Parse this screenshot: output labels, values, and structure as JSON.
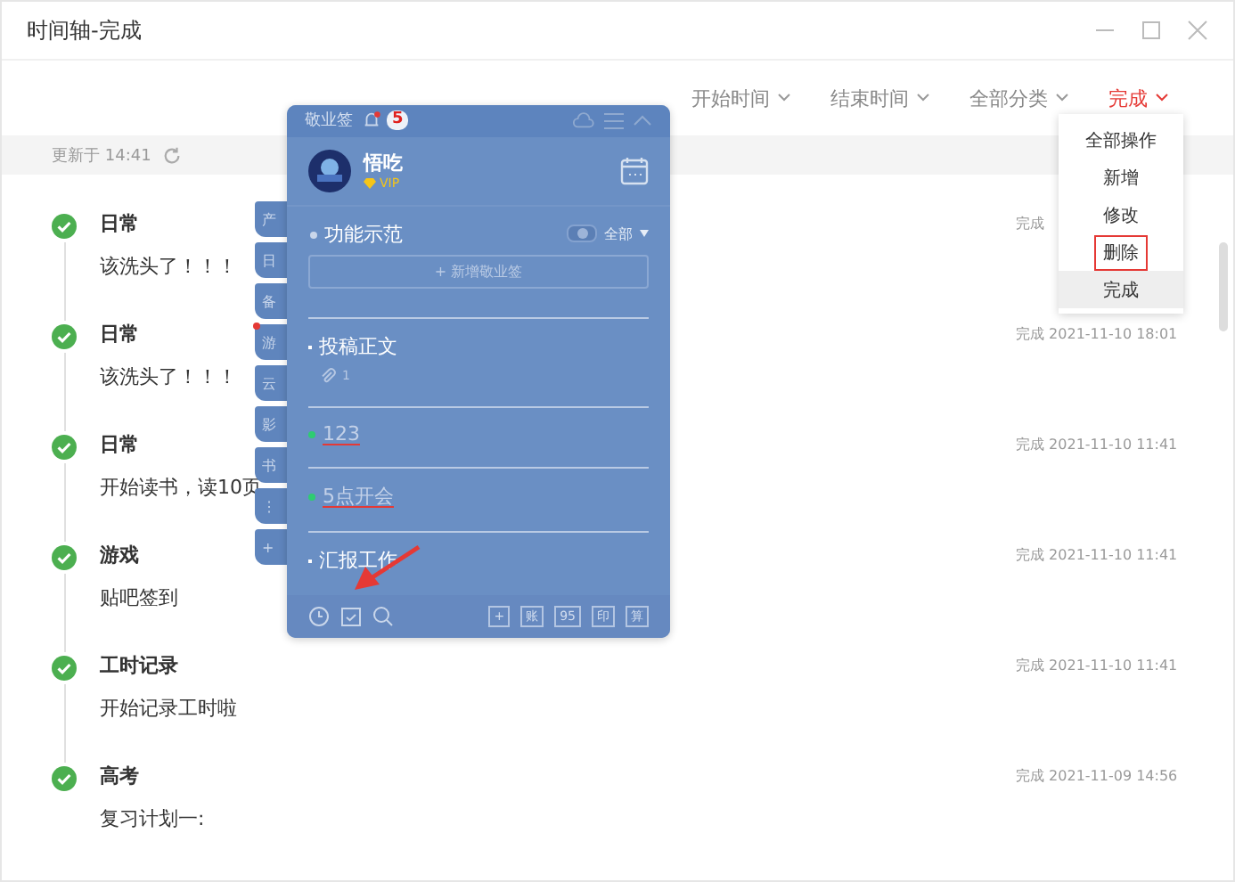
{
  "window": {
    "title": "时间轴-完成"
  },
  "filters": [
    {
      "label": "开始时间",
      "selected": false
    },
    {
      "label": "结束时间",
      "selected": false
    },
    {
      "label": "全部分类",
      "selected": false
    },
    {
      "label": "完成",
      "selected": true
    }
  ],
  "dropdown": [
    {
      "label": "全部操作",
      "selected": false,
      "outlined": false
    },
    {
      "label": "新增",
      "selected": false,
      "outlined": false
    },
    {
      "label": "修改",
      "selected": false,
      "outlined": false
    },
    {
      "label": "删除",
      "selected": false,
      "outlined": true
    },
    {
      "label": "完成",
      "selected": true,
      "outlined": false
    }
  ],
  "update_bar": {
    "text": "更新于 14:41"
  },
  "timeline": [
    {
      "category": "日常",
      "text": "该洗头了！！！",
      "date": "完成"
    },
    {
      "category": "日常",
      "text": "该洗头了！！！",
      "date": "完成 2021-11-10 18:01"
    },
    {
      "category": "日常",
      "text": "开始读书，读10页",
      "date": "完成 2021-11-10 11:41"
    },
    {
      "category": "游戏",
      "text": "贴吧签到",
      "date": "完成 2021-11-10 11:41"
    },
    {
      "category": "工时记录",
      "text": "开始记录工时啦",
      "date": "完成 2021-11-10 11:41"
    },
    {
      "category": "高考",
      "text": "复习计划一:",
      "date": "完成 2021-11-09 14:56"
    }
  ],
  "sticky_panel": {
    "title": "敬业签",
    "badge": "5",
    "user": "悟吃",
    "vip": "VIP",
    "side_tabs": [
      {
        "label": "产",
        "dot": false
      },
      {
        "label": "日",
        "dot": false
      },
      {
        "label": "备",
        "dot": false
      },
      {
        "label": "游",
        "dot": true
      },
      {
        "label": "云",
        "dot": false
      },
      {
        "label": "影",
        "dot": false
      },
      {
        "label": "书",
        "dot": false
      },
      {
        "label": "⋮",
        "dot": false
      },
      {
        "label": "+",
        "dot": false
      }
    ],
    "group": "功能示范",
    "toggle_on": false,
    "filter": "全部",
    "add_button": "+ 新增敬业签",
    "notes": [
      {
        "text": "投稿正文",
        "done": false,
        "attachments": "1"
      },
      {
        "text": "123",
        "done": true
      },
      {
        "text": "5点开会",
        "done": true
      },
      {
        "text": "汇报工作",
        "done": false
      }
    ],
    "tool_buttons": [
      "+",
      "账",
      "95",
      "印",
      "算"
    ]
  }
}
